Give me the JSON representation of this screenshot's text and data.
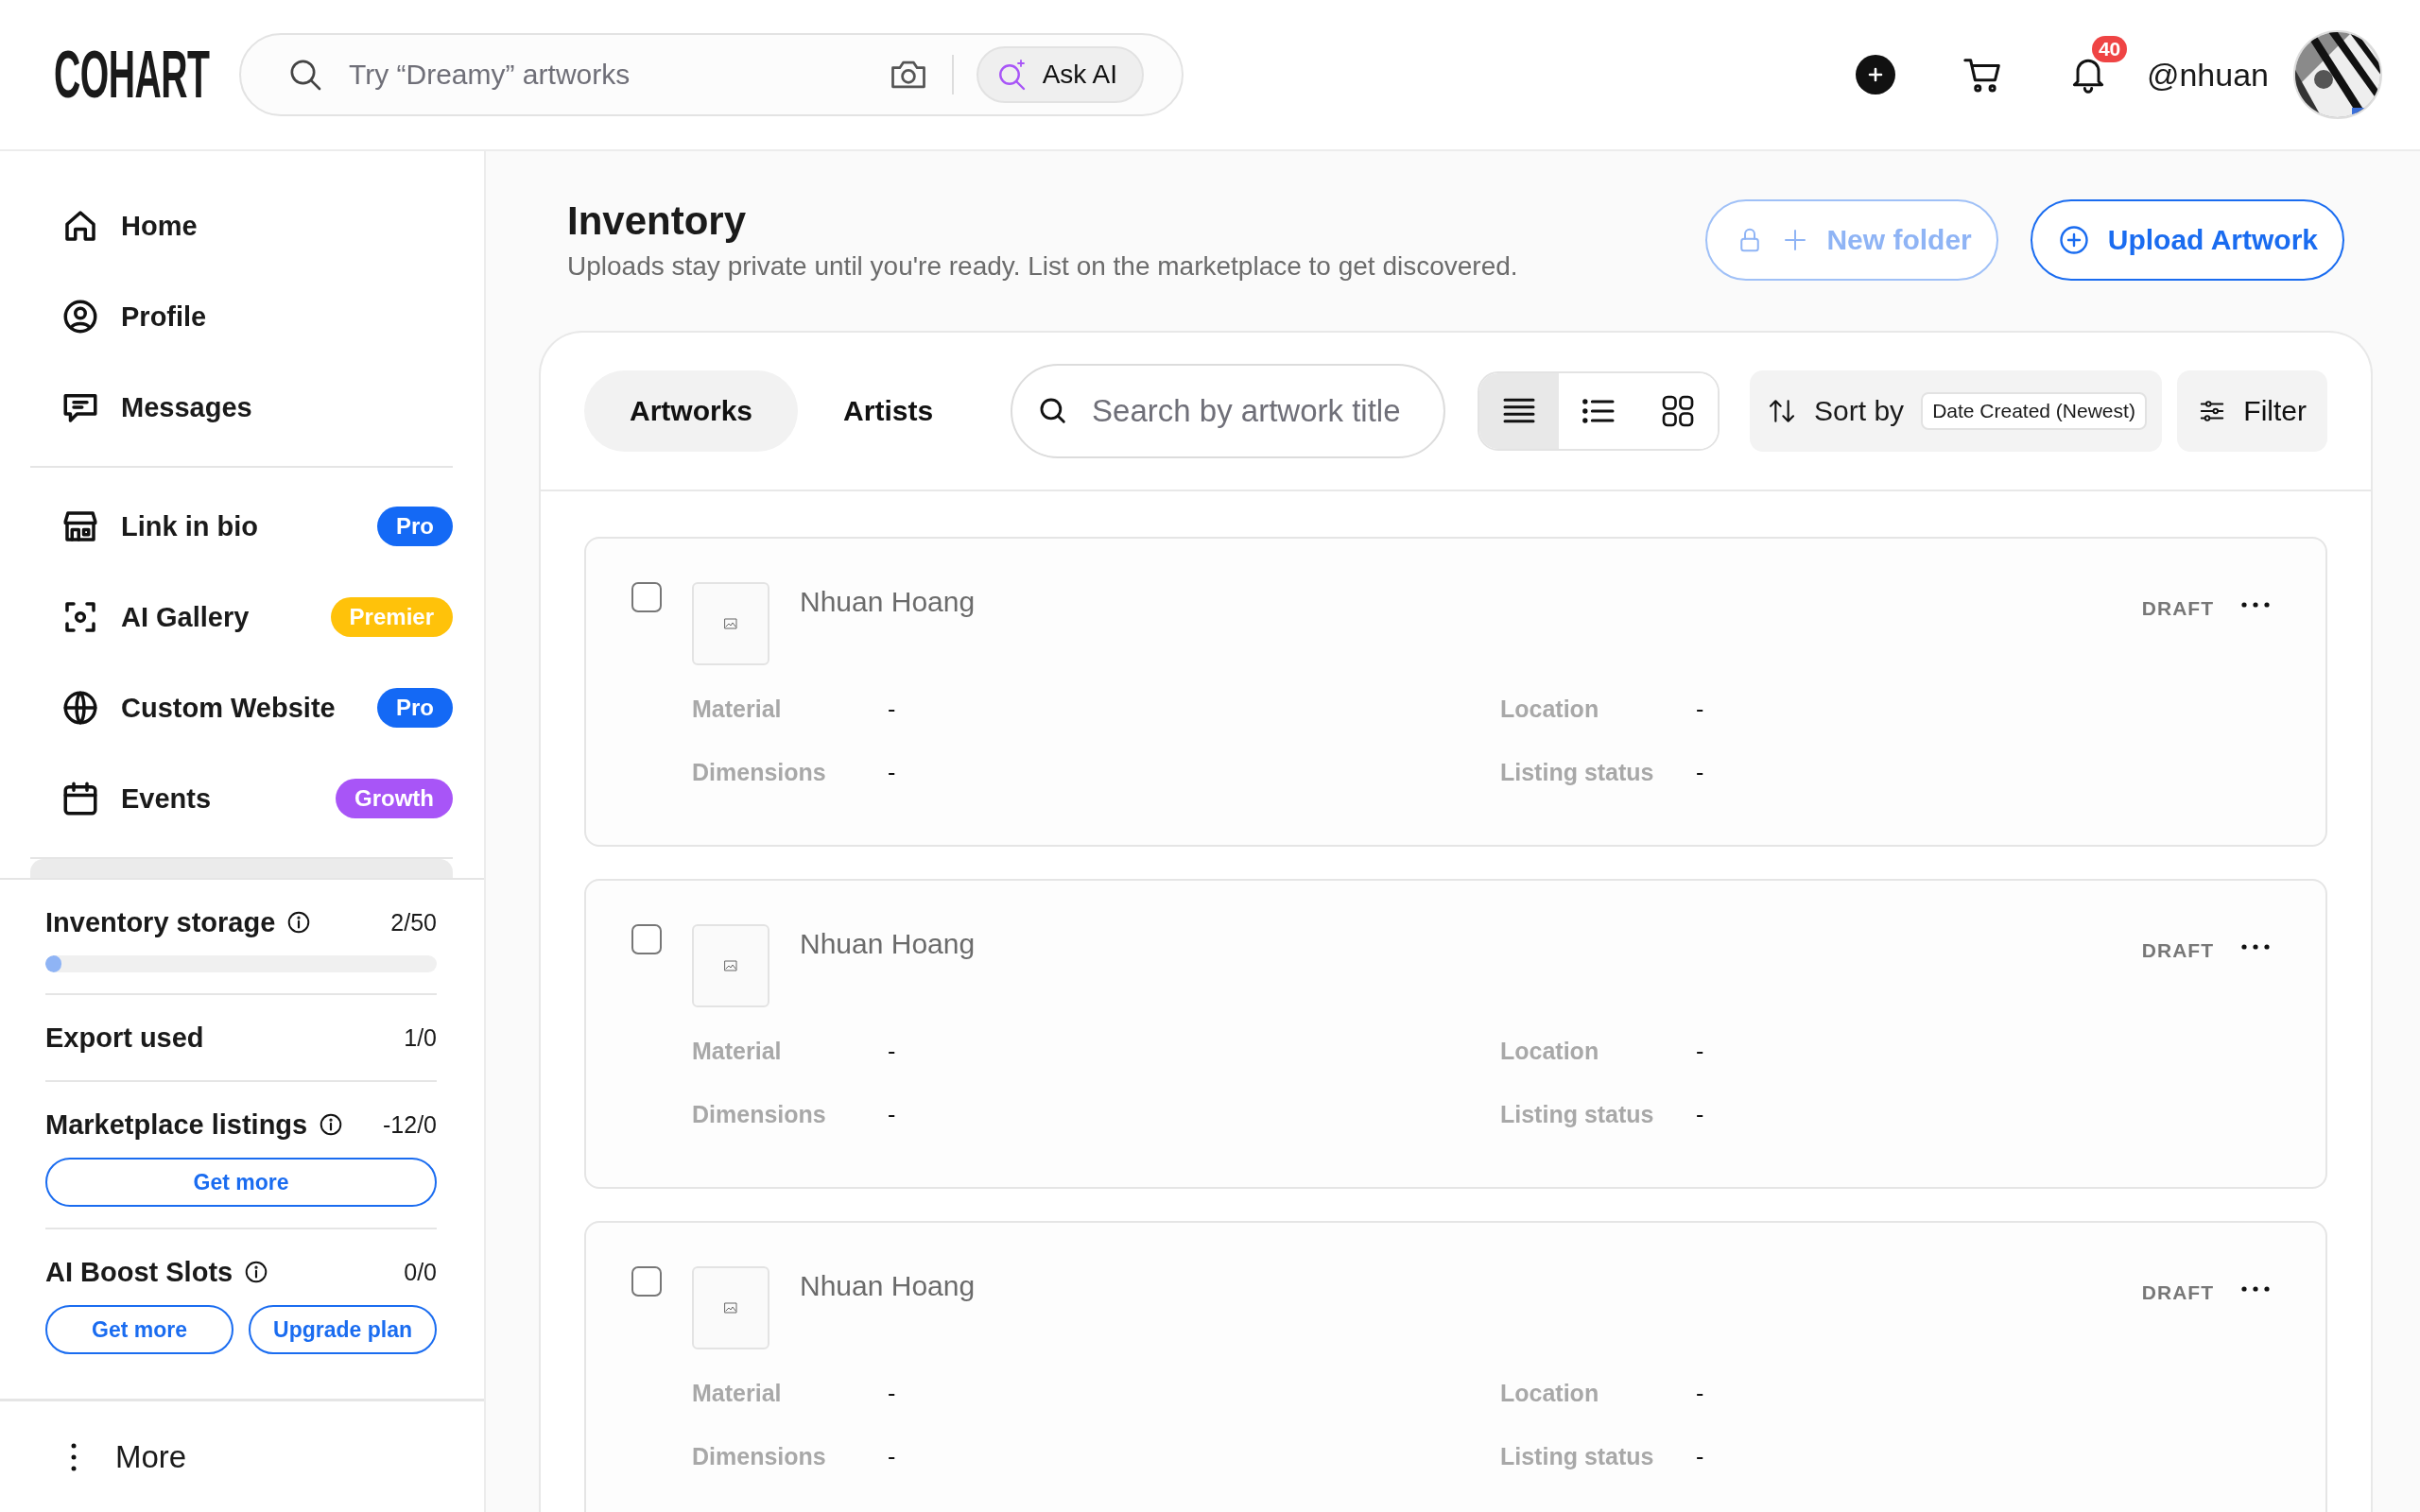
{
  "header": {
    "logo": "COHART",
    "search": {
      "placeholder": "Try “Dreamy” artworks"
    },
    "ask_ai": "Ask AI",
    "notifications": "40",
    "username": "@nhuan"
  },
  "sidebar": {
    "nav_groups": [
      [
        {
          "label": "Home",
          "kind": "home"
        },
        {
          "label": "Profile",
          "kind": "profile"
        },
        {
          "label": "Messages",
          "kind": "messages"
        }
      ],
      [
        {
          "label": "Link in bio",
          "kind": "store",
          "badge": {
            "label": "Pro",
            "color": "#1469f5"
          }
        },
        {
          "label": "AI Gallery",
          "kind": "scan",
          "badge": {
            "label": "Premier",
            "color": "#ffc20a"
          }
        },
        {
          "label": "Custom Website",
          "kind": "globe",
          "badge": {
            "label": "Pro",
            "color": "#1469f5"
          }
        },
        {
          "label": "Events",
          "kind": "calendar",
          "badge": {
            "label": "Growth",
            "color": "#a855f7"
          }
        }
      ]
    ],
    "usage": [
      {
        "label": "Inventory storage",
        "info": true,
        "value": "2/50",
        "level": 0.04
      },
      {
        "label": "Export used",
        "info": false,
        "value": "1/0"
      },
      {
        "label": "Marketplace listings",
        "info": true,
        "value": "-12/0",
        "buttons": [
          "Get more"
        ]
      },
      {
        "label": "AI Boost Slots",
        "info": true,
        "value": "0/0",
        "buttons": [
          "Get more",
          "Upgrade plan"
        ]
      }
    ],
    "more": "More"
  },
  "main": {
    "title": "Inventory",
    "subtitle": "Uploads stay private until you're ready. List on the marketplace to get discovered.",
    "actions": [
      {
        "label": "New folder",
        "kind": "folder",
        "disabled": true
      },
      {
        "label": "Upload Artwork",
        "kind": "upload",
        "disabled": false
      }
    ],
    "tabs": [
      {
        "label": "Artworks",
        "selected": true
      },
      {
        "label": "Artists",
        "selected": false
      }
    ],
    "search": {
      "placeholder": "Search by artwork title"
    },
    "view_modes": [
      {
        "kind": "rows",
        "selected": true
      },
      {
        "kind": "list",
        "selected": false
      },
      {
        "kind": "grid",
        "selected": false
      }
    ],
    "sort": {
      "label": "Sort by",
      "value": "Date Created (Newest)"
    },
    "filter": "Filter",
    "items": [
      {
        "name": "Nhuan Hoang",
        "status": "DRAFT",
        "checked": false,
        "fields": [
          {
            "label": "Material",
            "value": "-"
          },
          {
            "label": "Location",
            "value": "-"
          },
          {
            "label": "Dimensions",
            "value": "-"
          },
          {
            "label": "Listing status",
            "value": "-"
          }
        ]
      },
      {
        "name": "Nhuan Hoang",
        "status": "DRAFT",
        "checked": false,
        "fields": [
          {
            "label": "Material",
            "value": "-"
          },
          {
            "label": "Location",
            "value": "-"
          },
          {
            "label": "Dimensions",
            "value": "-"
          },
          {
            "label": "Listing status",
            "value": "-"
          }
        ]
      },
      {
        "name": "Nhuan Hoang",
        "status": "DRAFT",
        "checked": false,
        "fields": [
          {
            "label": "Material",
            "value": "-"
          },
          {
            "label": "Location",
            "value": "-"
          },
          {
            "label": "Dimensions",
            "value": "-"
          },
          {
            "label": "Listing status",
            "value": "-"
          }
        ]
      }
    ]
  }
}
